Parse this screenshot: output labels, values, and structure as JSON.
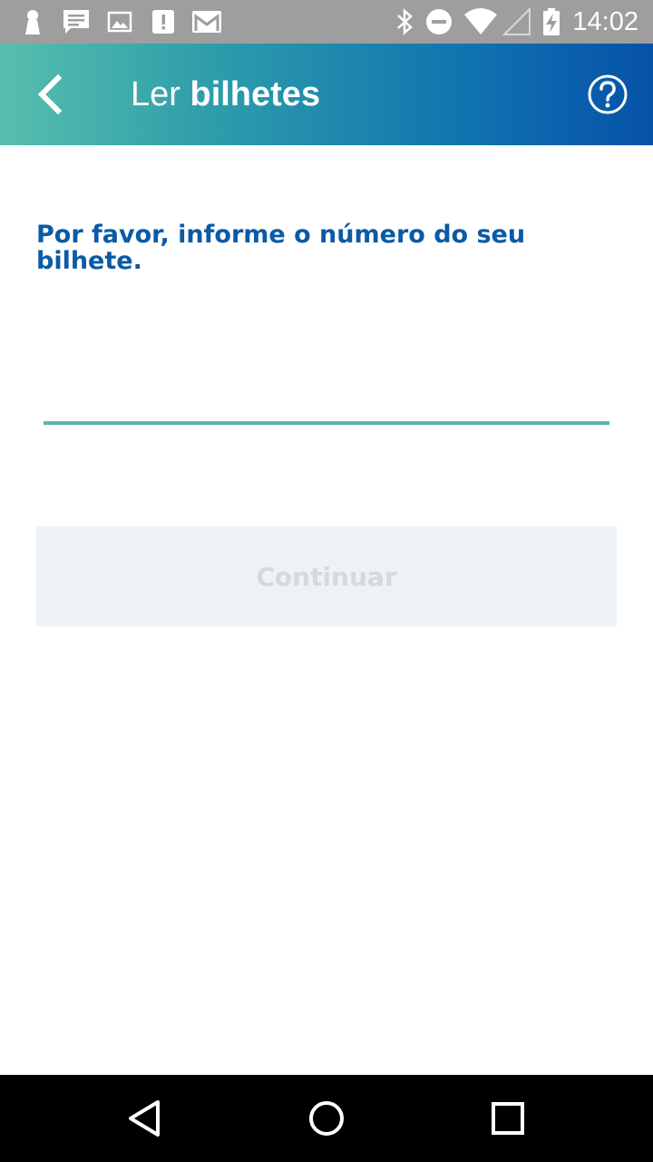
{
  "status_bar": {
    "time": "14:02",
    "left_icons": [
      "keyhole-icon",
      "message-icon",
      "image-icon",
      "alert-icon",
      "gmail-icon"
    ],
    "right_icons": [
      "bluetooth-icon",
      "do-not-disturb-icon",
      "wifi-icon",
      "signal-icon",
      "battery-charging-icon"
    ]
  },
  "app_bar": {
    "title_light": "Ler",
    "title_bold": "bilhetes",
    "back_icon": "chevron-left-icon",
    "help_icon": "help-circle-icon"
  },
  "form": {
    "prompt": "Por favor, informe o número do seu bilhete.",
    "ticket_value": "",
    "continue_label": "Continuar"
  },
  "nav_bar": {
    "icons": [
      "back-triangle-icon",
      "home-circle-icon",
      "recents-square-icon"
    ]
  },
  "colors": {
    "status_bar": "#9e9e9e",
    "gradient_start": "#57bfac",
    "gradient_end": "#0652a8",
    "prompt_text": "#0b5aa6",
    "underline": "#5bb7a5",
    "button_disabled_bg": "#eef2f4",
    "button_disabled_text": "#d3d9dc"
  }
}
